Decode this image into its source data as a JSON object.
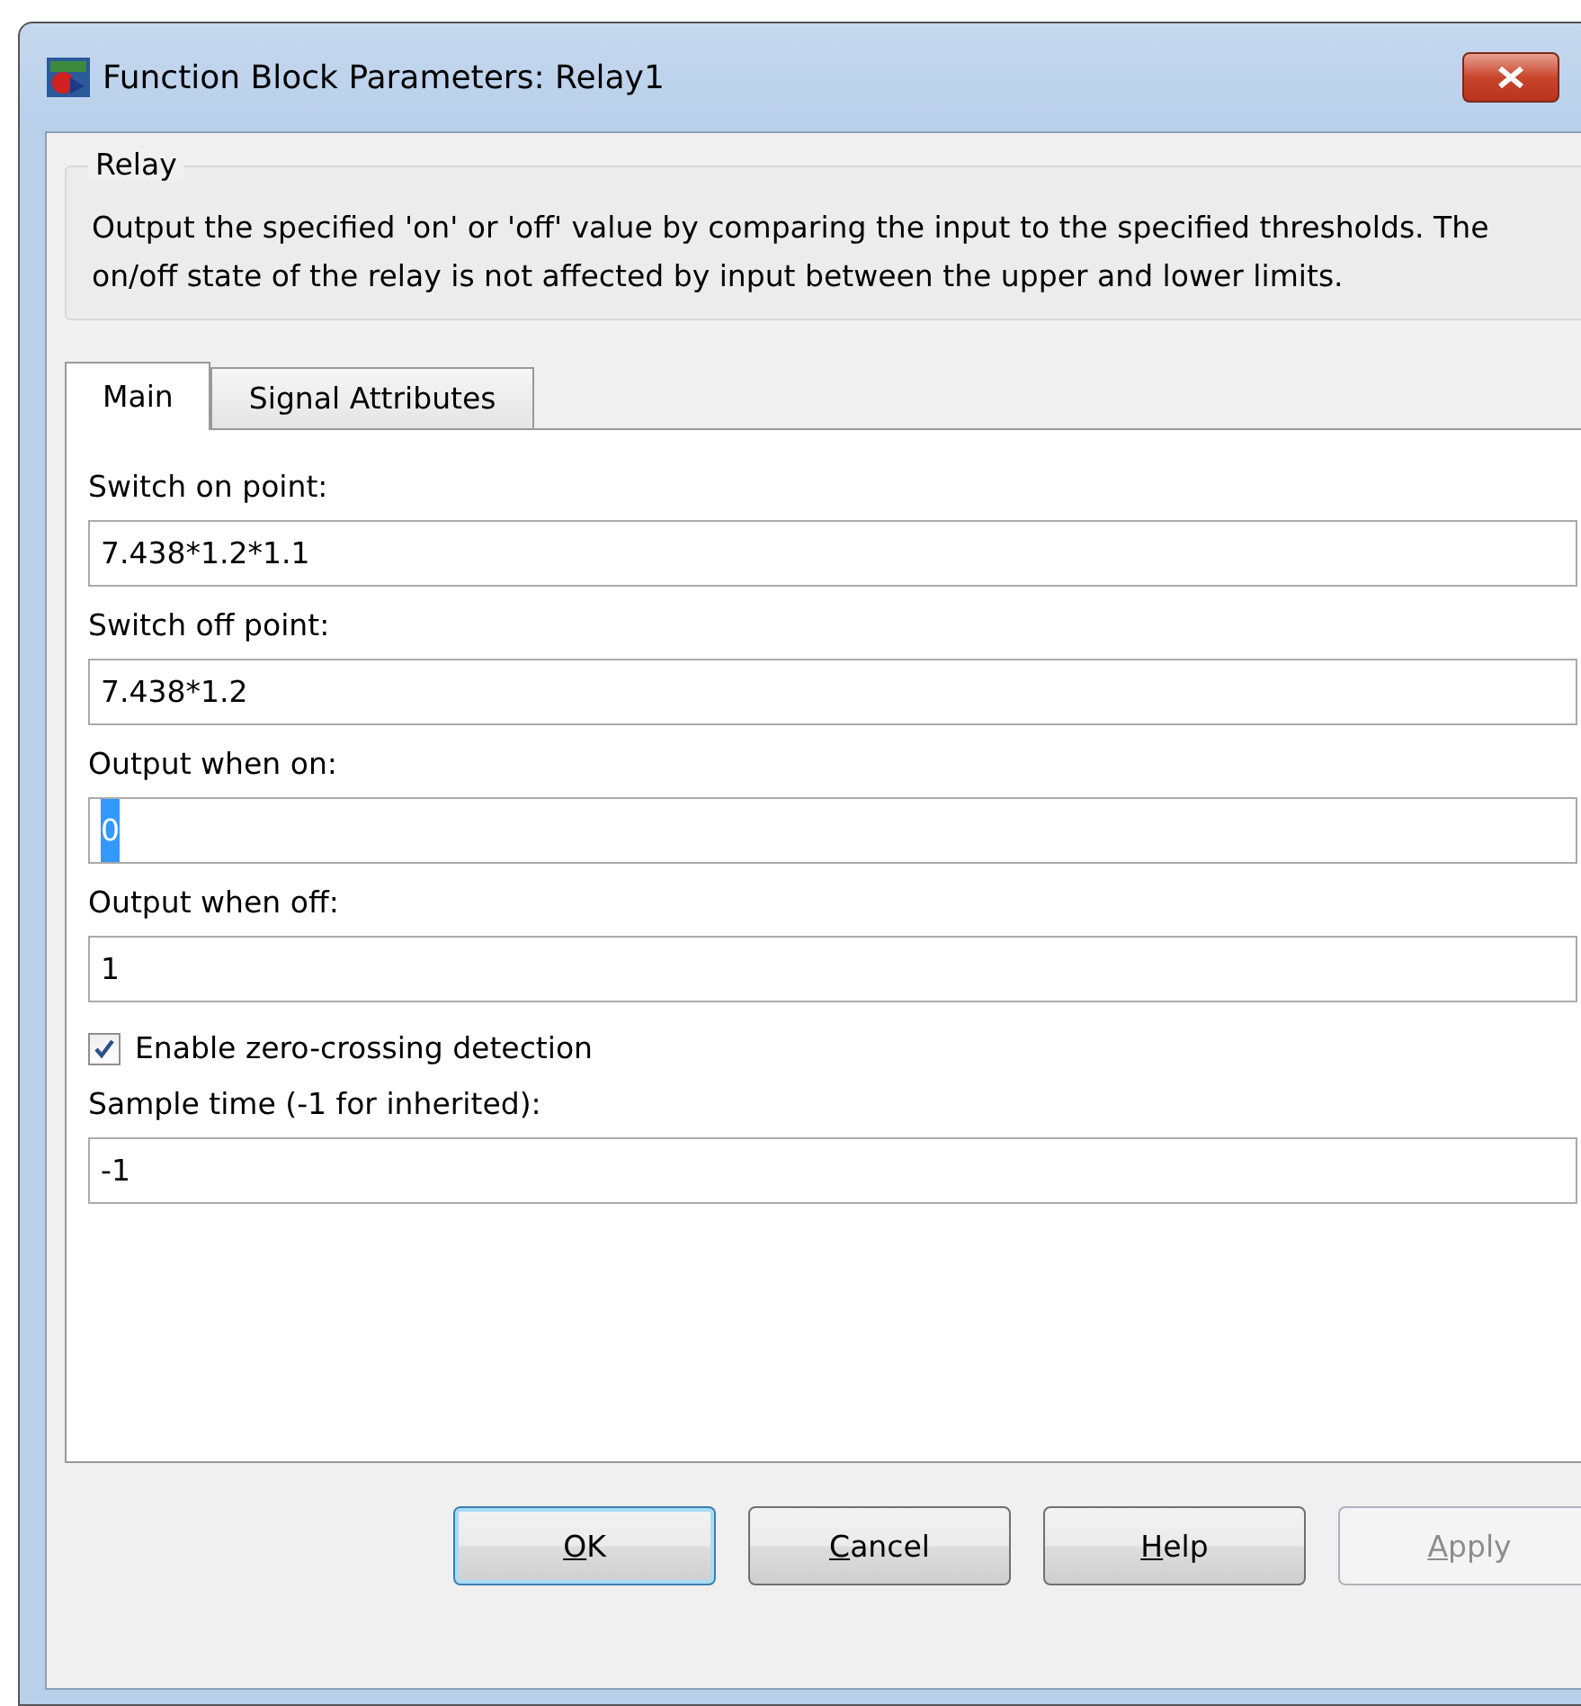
{
  "window": {
    "title": "Function Block Parameters: Relay1"
  },
  "description": {
    "title": "Relay",
    "text": "Output the specified 'on' or 'off' value by comparing the input to the specified thresholds.  The on/off state of the relay is not affected by input between the upper and lower limits."
  },
  "tabs": [
    {
      "label": "Main",
      "selected": true
    },
    {
      "label": "Signal Attributes",
      "selected": false
    }
  ],
  "parameters": [
    {
      "kind": "field",
      "label": "Switch on point:",
      "value": "7.438*1.2*1.1",
      "text_selected": false
    },
    {
      "kind": "field",
      "label": "Switch off point:",
      "value": "7.438*1.2",
      "text_selected": false
    },
    {
      "kind": "field",
      "label": "Output when on:",
      "value": "0",
      "text_selected": true
    },
    {
      "kind": "field",
      "label": "Output when off:",
      "value": "1",
      "text_selected": false
    },
    {
      "kind": "checkbox",
      "label": "Enable zero-crossing detection",
      "checked": true
    },
    {
      "kind": "field",
      "label": "Sample time (-1 for inherited):",
      "value": "-1",
      "text_selected": false
    }
  ],
  "buttons": [
    {
      "label": "OK",
      "default": true,
      "disabled": false
    },
    {
      "label": "Cancel",
      "default": false,
      "disabled": false
    },
    {
      "label": "Help",
      "default": false,
      "disabled": false
    },
    {
      "label": "Apply",
      "default": false,
      "disabled": true
    }
  ]
}
